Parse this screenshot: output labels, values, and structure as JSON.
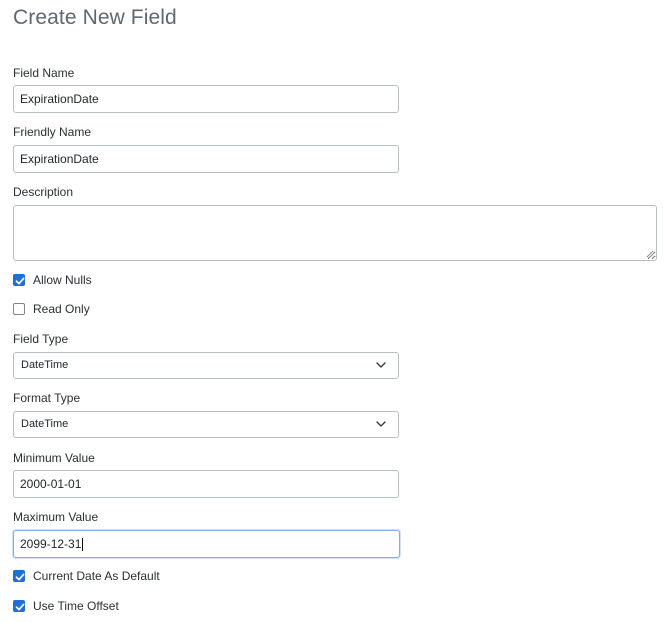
{
  "page": {
    "title": "Create New Field"
  },
  "form": {
    "field_name": {
      "label": "Field Name",
      "value": "ExpirationDate"
    },
    "friendly_name": {
      "label": "Friendly Name",
      "value": "ExpirationDate"
    },
    "description": {
      "label": "Description",
      "value": ""
    },
    "allow_nulls": {
      "label": "Allow Nulls",
      "checked": true
    },
    "read_only": {
      "label": "Read Only",
      "checked": false
    },
    "field_type": {
      "label": "Field Type",
      "selected": "DateTime"
    },
    "format_type": {
      "label": "Format Type",
      "selected": "DateTime"
    },
    "minimum_value": {
      "label": "Minimum Value",
      "value": "2000-01-01"
    },
    "maximum_value": {
      "label": "Maximum Value",
      "value": "2099-12-31"
    },
    "current_date_as_default": {
      "label": "Current Date As Default",
      "checked": true
    },
    "use_time_offset": {
      "label": "Use Time Offset",
      "checked": true
    }
  },
  "icons": {
    "dropdown": "chevron-down-icon",
    "check": "checkmark-icon"
  },
  "colors": {
    "accent": "#1f6fd6",
    "title": "#5f6771",
    "border": "#b8bec5",
    "focus_border": "#86a8f0"
  }
}
